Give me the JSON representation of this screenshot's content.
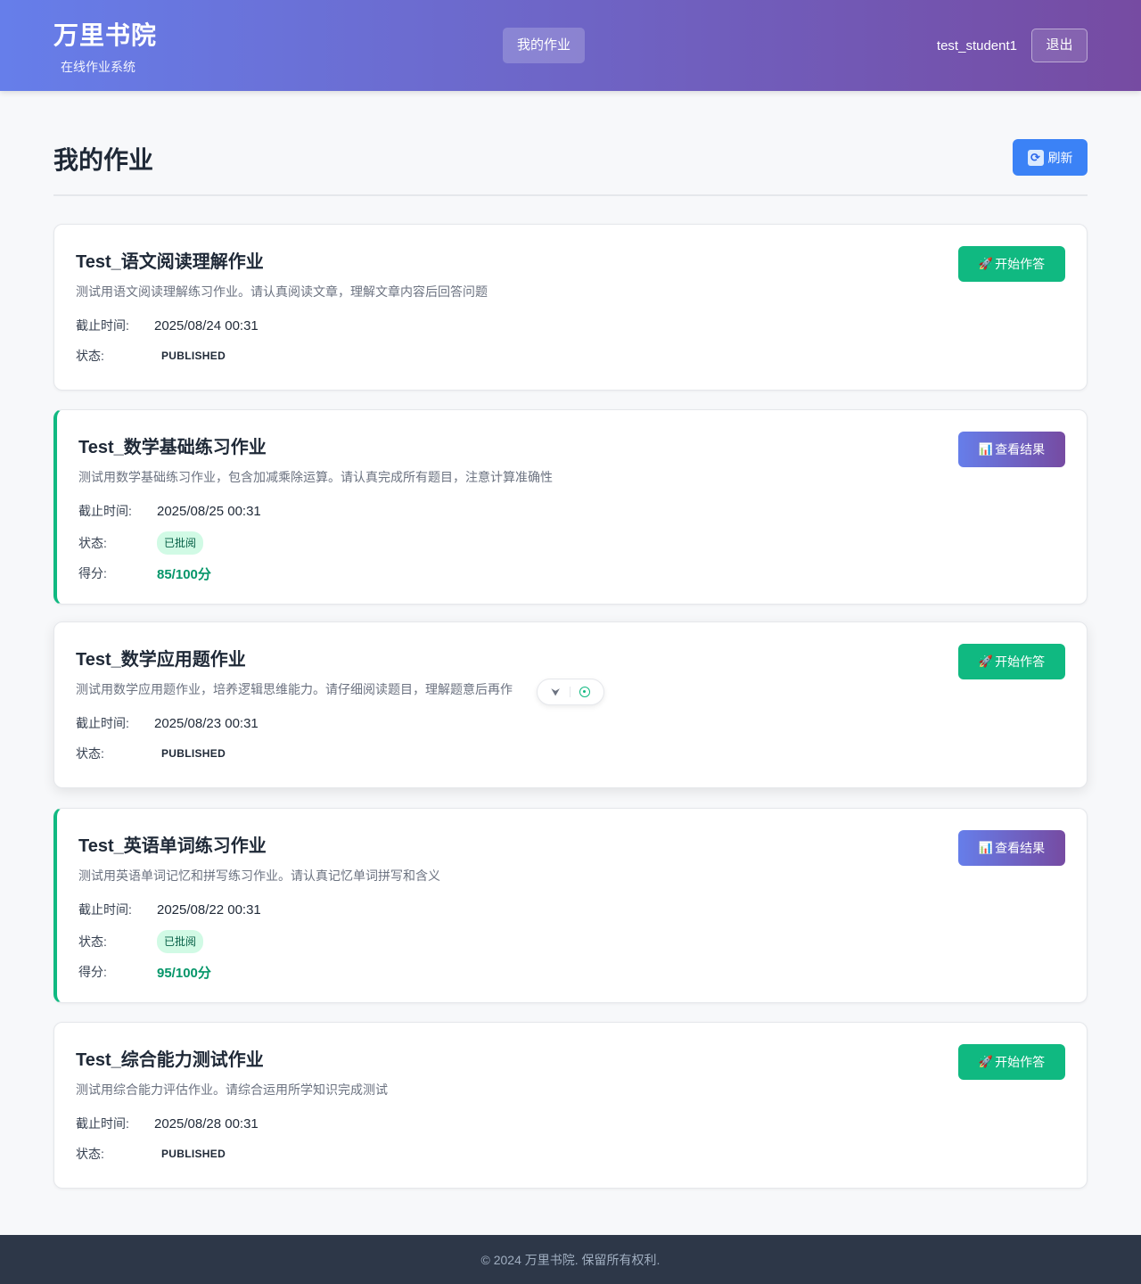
{
  "header": {
    "brand_title": "万里书院",
    "brand_subtitle": "在线作业系统",
    "nav_my_homework": "我的作业",
    "username": "test_student1",
    "logout_label": "退出"
  },
  "page": {
    "title": "我的作业",
    "refresh_label": "刷新",
    "refresh_icon": "refresh-icon"
  },
  "labels": {
    "deadline": "截止时间:",
    "status": "状态:",
    "score": "得分:"
  },
  "assignments": [
    {
      "title": "Test_语文阅读理解作业",
      "description": "测试用语文阅读理解练习作业。请认真阅读文章，理解文章内容后回答问题",
      "deadline": "2025/08/24 00:31",
      "status": "PUBLISHED",
      "action_label": "开始作答",
      "action_icon": "rocket-icon"
    },
    {
      "title": "Test_数学基础练习作业",
      "description": "测试用数学基础练习作业，包含加减乘除运算。请认真完成所有题目，注意计算准确性",
      "deadline": "2025/08/25 00:31",
      "status": "已批阅",
      "score": "85/100分",
      "action_label": "查看结果",
      "action_icon": "bar-chart-icon"
    },
    {
      "title": "Test_数学应用题作业",
      "description": "测试用数学应用题作业，培养逻辑思维能力。请仔细阅读题目，理解题意后再作",
      "deadline": "2025/08/23 00:31",
      "status": "PUBLISHED",
      "action_label": "开始作答",
      "action_icon": "rocket-icon"
    },
    {
      "title": "Test_英语单词练习作业",
      "description": "测试用英语单词记忆和拼写练习作业。请认真记忆单词拼写和含义",
      "deadline": "2025/08/22 00:31",
      "status": "已批阅",
      "score": "95/100分",
      "action_label": "查看结果",
      "action_icon": "bar-chart-icon"
    },
    {
      "title": "Test_综合能力测试作业",
      "description": "测试用综合能力评估作业。请综合运用所学知识完成测试",
      "deadline": "2025/08/28 00:31",
      "status": "PUBLISHED",
      "action_label": "开始作答",
      "action_icon": "rocket-icon"
    }
  ],
  "footer": {
    "copyright": "© 2024 万里书院. 保留所有权利."
  },
  "colors": {
    "header_gradient_start": "#667eea",
    "header_gradient_end": "#764ba2",
    "primary_blue": "#3b82f6",
    "success_green": "#10b981",
    "score_green": "#059669",
    "footer_bg": "#2d3748"
  }
}
